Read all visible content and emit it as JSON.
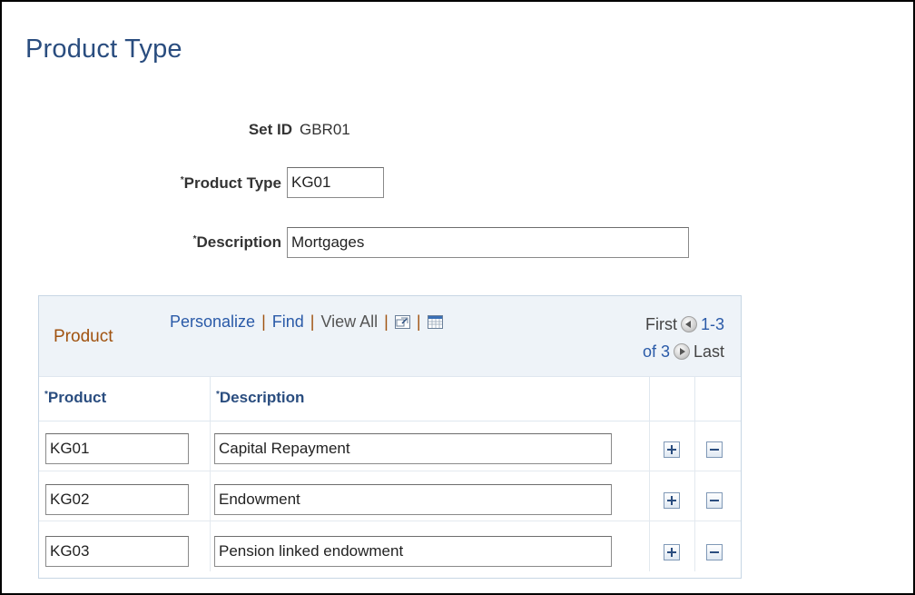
{
  "page": {
    "title": "Product Type"
  },
  "form": {
    "setid_label": "Set ID",
    "setid_value": "GBR01",
    "product_type_label": "Product Type",
    "product_type_value": "KG01",
    "description_label": "Description",
    "description_value": "Mortgages"
  },
  "grid": {
    "title": "Product",
    "nav": {
      "personalize": "Personalize",
      "find": "Find",
      "view_all": "View All",
      "sep": "|",
      "zoom_icon": "new-window-icon",
      "download_icon": "spreadsheet-icon"
    },
    "pager": {
      "first": "First",
      "range": "1-3",
      "of": "of 3",
      "last": "Last",
      "prev_icon": "previous-circle-icon",
      "next_icon": "next-circle-icon"
    },
    "columns": {
      "product": "Product",
      "description": "Description"
    },
    "rows": [
      {
        "product": "KG01",
        "description": "Capital Repayment"
      },
      {
        "product": "KG02",
        "description": "Endowment"
      },
      {
        "product": "KG03",
        "description": "Pension linked endowment"
      }
    ],
    "row_actions": {
      "add_icon": "plus-icon",
      "delete_icon": "minus-icon"
    }
  },
  "required_marker": "*",
  "colors": {
    "title": "#2a4d7f",
    "link": "#2a5aa8",
    "grid_title": "#a0520f",
    "grid_header_bg": "#eef3f8"
  }
}
